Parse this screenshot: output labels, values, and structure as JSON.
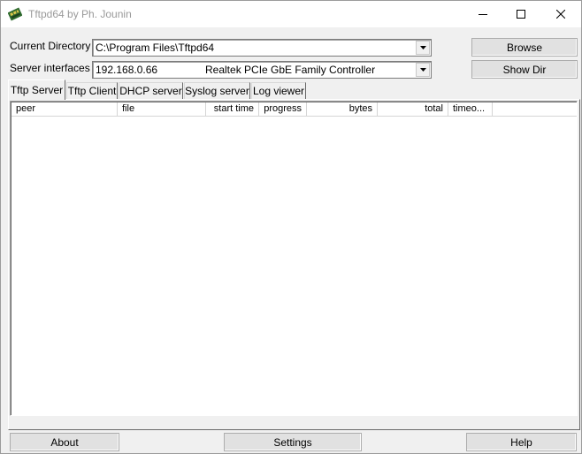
{
  "window": {
    "title": "Tftpd64 by Ph. Jounin"
  },
  "labels": {
    "current_directory": "Current Directory",
    "server_interfaces": "Server interfaces"
  },
  "current_directory": {
    "value": "C:\\Program Files\\Tftpd64"
  },
  "server_interface": {
    "ip": "192.168.0.66",
    "adapter": "Realtek PCIe GbE Family Controller"
  },
  "buttons": {
    "browse": "Browse",
    "show_dir": "Show Dir",
    "about": "About",
    "settings": "Settings",
    "help": "Help"
  },
  "tabs": [
    {
      "label": "Tftp Server",
      "active": true
    },
    {
      "label": "Tftp Client",
      "active": false
    },
    {
      "label": "DHCP server",
      "active": false
    },
    {
      "label": "Syslog server",
      "active": false
    },
    {
      "label": "Log viewer",
      "active": false
    }
  ],
  "columns": [
    "peer",
    "file",
    "start time",
    "progress",
    "bytes",
    "total",
    "timeo..."
  ],
  "colors": {
    "window_bg": "#f0f0f0",
    "list_bg": "#ffffff",
    "title_text": "#9a9a9a"
  }
}
